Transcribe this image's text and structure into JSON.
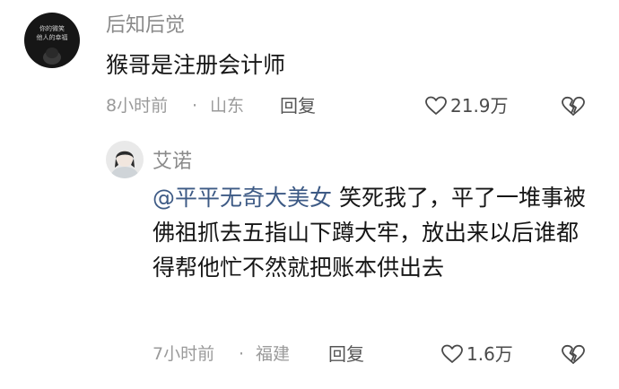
{
  "comments": [
    {
      "username": "后知后觉",
      "avatar_text_line1": "你的微笑",
      "avatar_text_line2": "他人的幸福",
      "text": "猴哥是注册会计师",
      "time": "8小时前",
      "separator": "·",
      "location": "山东",
      "reply_label": "回复",
      "likes": "21.9万",
      "icons": {
        "like": "heart-outline-icon",
        "dislike": "broken-heart-icon"
      }
    },
    {
      "username": "艾诺",
      "mention": "@平平无奇大美女",
      "text": "笑死我了，平了一堆事被佛祖抓去五指山下蹲大牢，放出来以后谁都得帮他忙不然就把账本供出去",
      "time": "7小时前",
      "separator": "·",
      "location": "福建",
      "reply_label": "回复",
      "likes": "1.6万",
      "icons": {
        "like": "heart-outline-icon",
        "dislike": "broken-heart-icon"
      }
    }
  ],
  "colors": {
    "username": "#8a8a8a",
    "mention": "#3d5a85",
    "meta": "#9a9a9a"
  }
}
